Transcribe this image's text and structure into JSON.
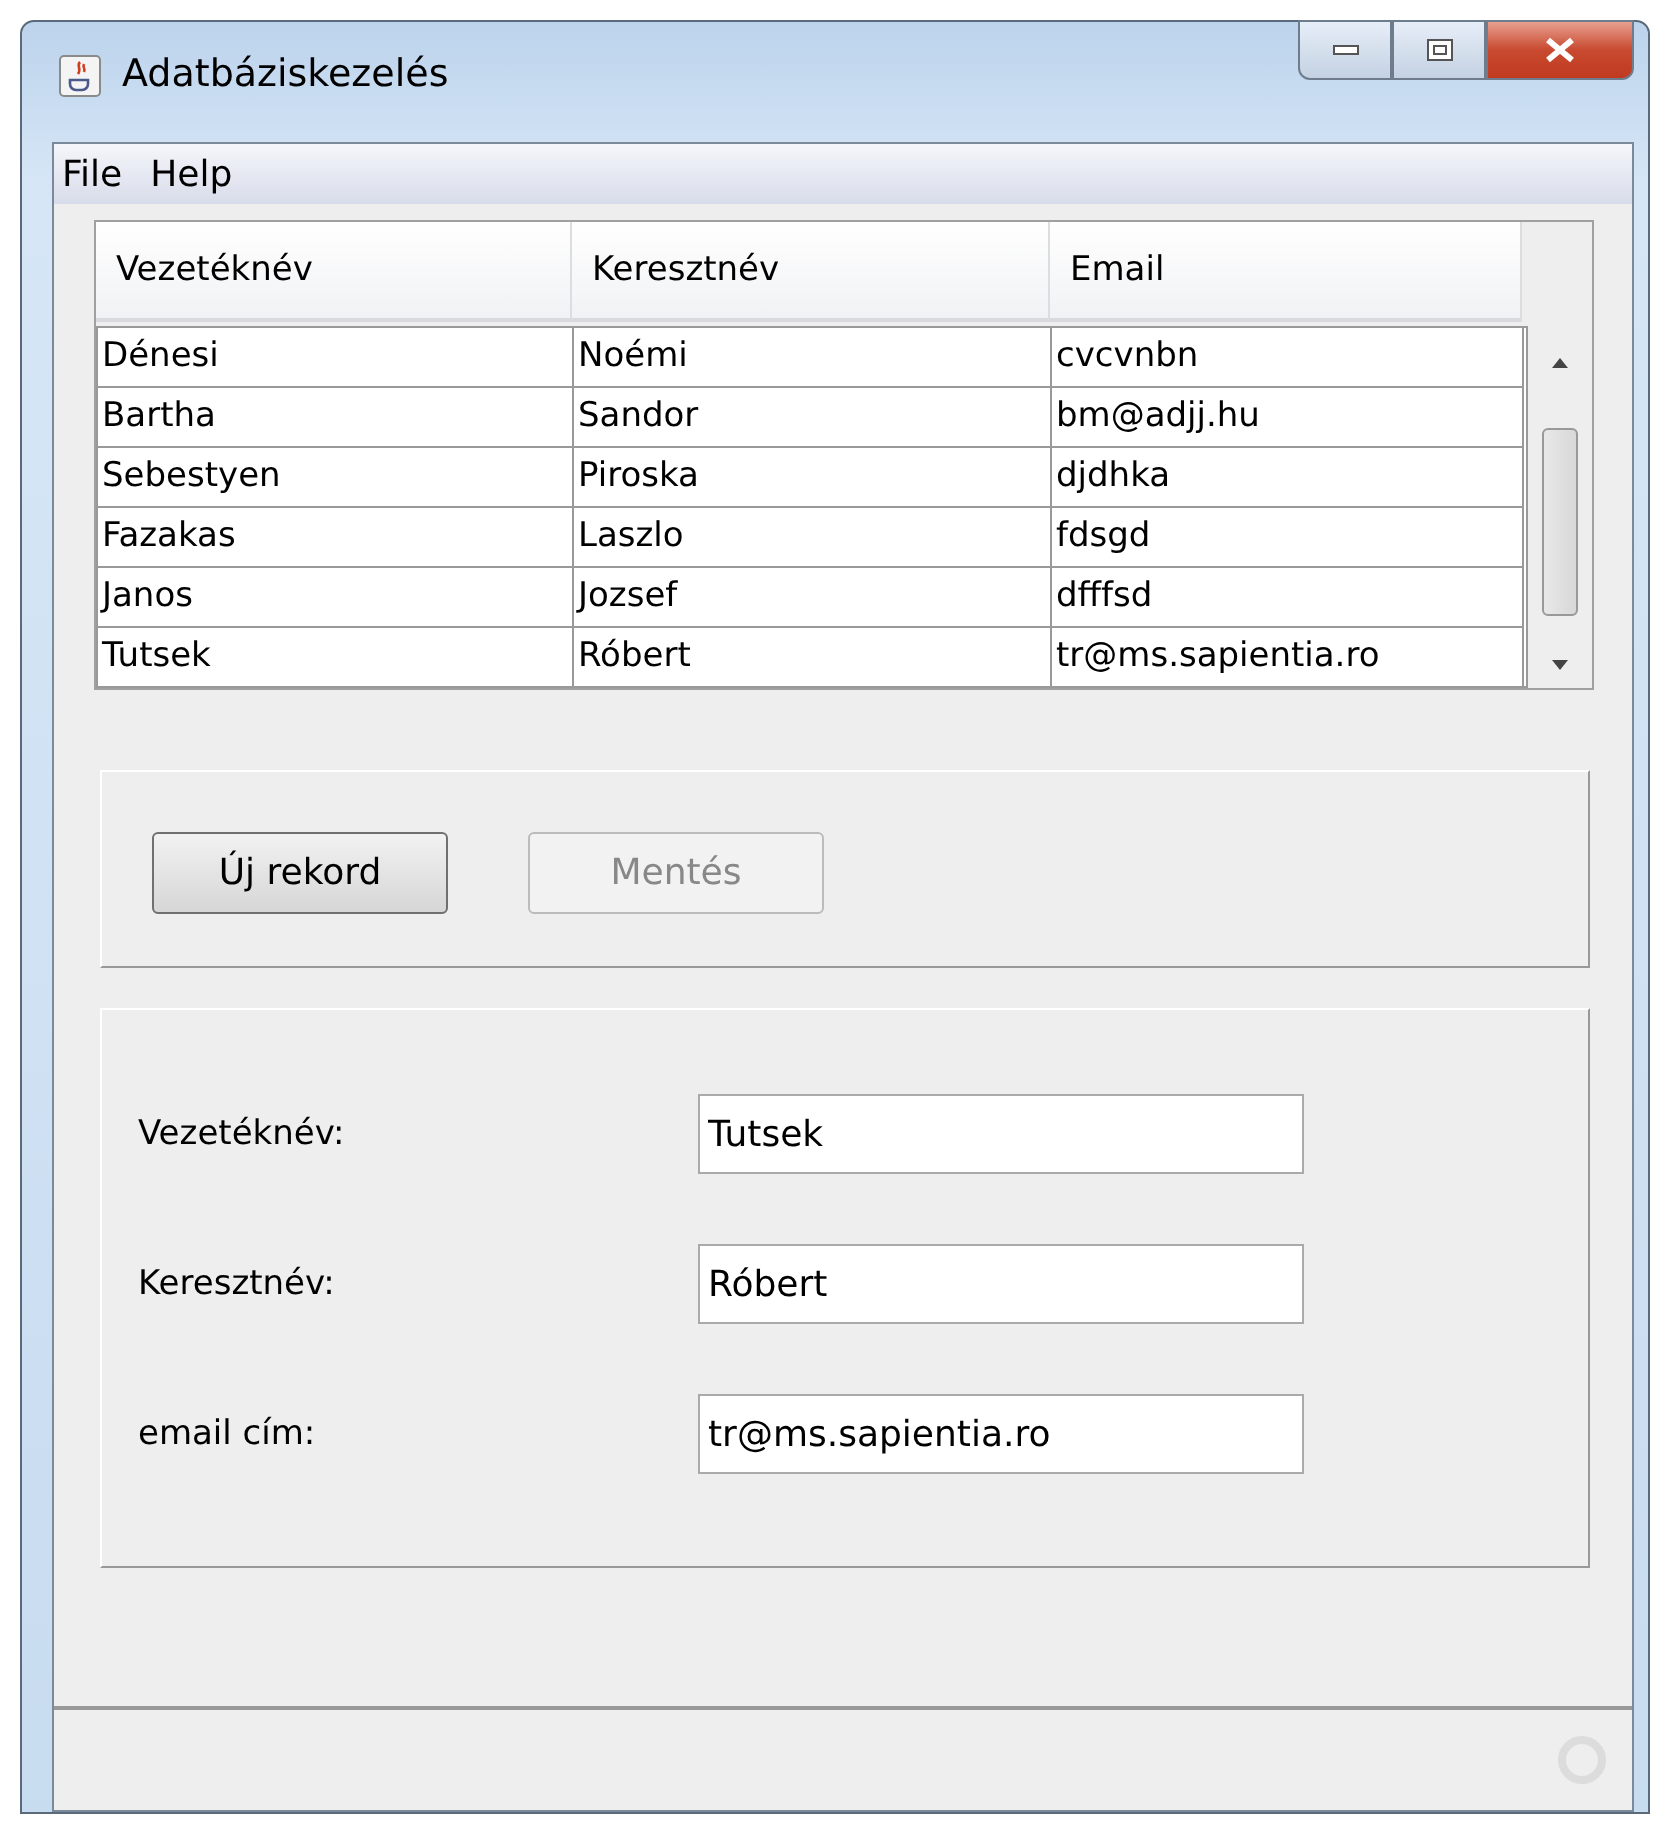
{
  "window": {
    "title": "Adatbáziskezelés"
  },
  "menu": [
    {
      "label": "File"
    },
    {
      "label": "Help"
    }
  ],
  "table": {
    "columns": [
      "Vezetéknév",
      "Keresztnév",
      "Email"
    ],
    "rows": [
      [
        "Dénesi",
        "Noémi",
        "cvcvnbn"
      ],
      [
        "Bartha",
        "Sandor",
        "bm@adjj.hu"
      ],
      [
        "Sebestyen",
        "Piroska",
        "djdhka"
      ],
      [
        "Fazakas",
        "Laszlo",
        "fdsgd"
      ],
      [
        "Janos",
        "Jozsef",
        "dfffsd"
      ],
      [
        "Tutsek",
        "Róbert",
        "tr@ms.sapientia.ro"
      ]
    ]
  },
  "buttons": [
    {
      "label": "Új rekord",
      "disabled": false
    },
    {
      "label": "Mentés",
      "disabled": true
    }
  ],
  "form": [
    {
      "label": "Vezetéknév:",
      "value": "Tutsek"
    },
    {
      "label": "Keresztnév:",
      "value": "Róbert"
    },
    {
      "label": "email cím:",
      "value": "tr@ms.sapientia.ro"
    }
  ]
}
